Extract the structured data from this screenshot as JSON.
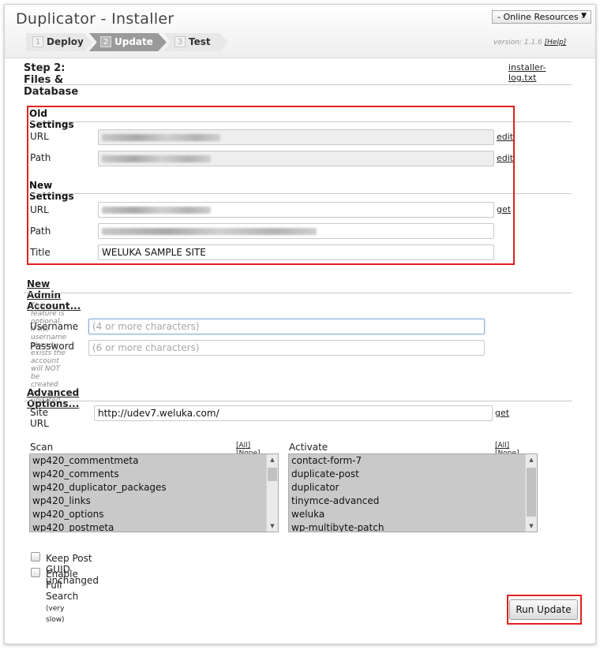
{
  "header": {
    "app_title": "Duplicator - Installer",
    "resources_label": "- Online Resources -",
    "resources_arrow": "▼",
    "version_text": "version: 1.1.6",
    "help_link": "[Help]",
    "steps": [
      {
        "num": "1",
        "label": "Deploy"
      },
      {
        "num": "2",
        "label": "Update"
      },
      {
        "num": "3",
        "label": "Test"
      }
    ]
  },
  "page": {
    "step_title": "Step 2: Files & Database",
    "log_link": "installer-log.txt"
  },
  "old_settings": {
    "heading": "Old Settings",
    "url_label": "URL",
    "path_label": "Path",
    "edit_label": "edit"
  },
  "new_settings": {
    "heading": "New Settings",
    "url_label": "URL",
    "path_label": "Path",
    "title_label": "Title",
    "title_value": "WELUKA SAMPLE SITE",
    "get_label": "get"
  },
  "admin": {
    "heading": "New Admin Account...",
    "note": "This feature is optional. If the username already exists the account will NOT be created or updated.",
    "username_label": "Username",
    "username_placeholder": "(4 or more characters)",
    "password_label": "Password",
    "password_placeholder": "(6 or more characters)"
  },
  "advanced": {
    "heading": "Advanced Options...",
    "site_url_label": "Site URL",
    "site_url_value": "http://udev7.weluka.com/",
    "get_label": "get",
    "scan_tables_label": "Scan Tables",
    "activate_plugins_label": "Activate Plugins",
    "all_label": "[All]",
    "none_label": "[None]",
    "tables": [
      "wp420_commentmeta",
      "wp420_comments",
      "wp420_duplicator_packages",
      "wp420_links",
      "wp420_options",
      "wp420_postmeta"
    ],
    "plugins": [
      "contact-form-7",
      "duplicate-post",
      "duplicator",
      "tinymce-advanced",
      "weluka",
      "wp-multibyte-patch"
    ],
    "keep_guid_label": "Keep Post GUID unchanged",
    "full_search_label": "Enable Full Search",
    "full_search_note": "(very slow)"
  },
  "actions": {
    "run_update_label": "Run Update"
  },
  "colors": {
    "highlight_red": "#e02020",
    "active_step": "#9a9a9a"
  }
}
